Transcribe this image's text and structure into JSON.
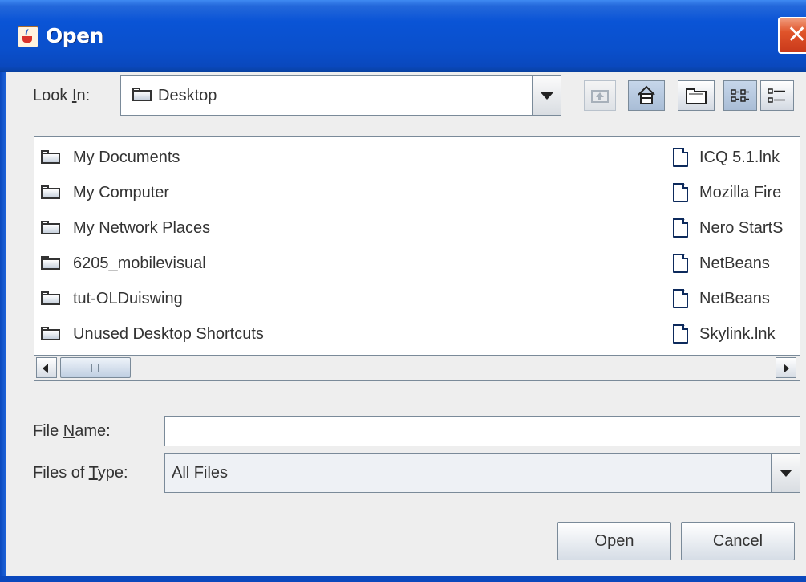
{
  "window": {
    "title": "Open",
    "title_bar_color": "#0a54d6",
    "close_icon": "close-icon"
  },
  "toolbar": {
    "look_in_label": "Look In:",
    "look_in_mnemonic": "I",
    "look_in_value": "Desktop",
    "buttons": [
      {
        "name": "up-one-level-button",
        "icon": "up-folder-icon",
        "enabled": false
      },
      {
        "name": "home-button",
        "icon": "home-icon",
        "enabled": true
      },
      {
        "name": "new-folder-button",
        "icon": "new-folder-icon",
        "enabled": true
      },
      {
        "name": "list-view-button",
        "icon": "list-view-icon",
        "selected": true
      },
      {
        "name": "details-view-button",
        "icon": "details-view-icon",
        "selected": false
      }
    ]
  },
  "file_list": {
    "folders": [
      {
        "name": "My Documents"
      },
      {
        "name": "My Computer"
      },
      {
        "name": "My Network Places"
      },
      {
        "name": "6205_mobilevisual"
      },
      {
        "name": "tut-OLDuiswing"
      },
      {
        "name": "Unused Desktop Shortcuts"
      }
    ],
    "files": [
      {
        "name": "ICQ 5.1.lnk"
      },
      {
        "name": "Mozilla Fire"
      },
      {
        "name": "Nero StartS"
      },
      {
        "name": "NetBeans"
      },
      {
        "name": "NetBeans"
      },
      {
        "name": "Skylink.lnk"
      }
    ],
    "scroll_position": 0
  },
  "form": {
    "file_name_label": "File Name:",
    "file_name_mnemonic": "N",
    "file_name_value": "",
    "files_of_type_label": "Files of Type:",
    "files_of_type_mnemonic": "T",
    "files_of_type_value": "All Files"
  },
  "buttons": {
    "open_label": "Open",
    "cancel_label": "Cancel"
  }
}
